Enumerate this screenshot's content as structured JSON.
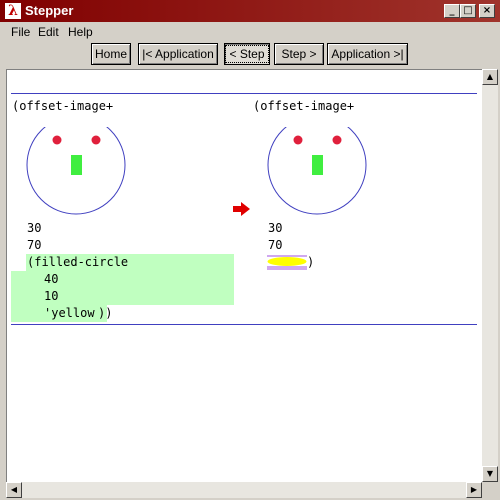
{
  "window": {
    "title": "Stepper",
    "app_icon": "λ",
    "minimize": "_",
    "maximize": "□",
    "close": "×"
  },
  "menu": {
    "items": [
      "File",
      "Edit",
      "Help"
    ]
  },
  "toolbar": {
    "home": "Home",
    "back_application": "|< Application",
    "back_step": "< Step",
    "forward_step": "Step >",
    "forward_application": "Application >|"
  },
  "left_expr": {
    "head": "(offset-image+",
    "arg1": "30",
    "arg2": "70",
    "redex_line1": "(filled-circle",
    "redex_line2": "40",
    "redex_line3": "10",
    "redex_line4": "'yellow",
    "closing": "))"
  },
  "right_expr": {
    "head": "(offset-image+",
    "arg1": "30",
    "arg2": "70",
    "closing": ")"
  },
  "colors": {
    "redex_highlight": "#c0ffc0",
    "contractum_highlight": "#d0a8f0",
    "face_outline": "#4040c0",
    "eyes": "#e0203c",
    "nose": "#40ee40",
    "result_ellipse": "#ffff00",
    "arrow": "#e00000"
  },
  "icons": {
    "arrow": "red-right-arrow",
    "scroll_up": "triangle-up",
    "scroll_down": "triangle-down",
    "scroll_left": "triangle-left",
    "scroll_right": "triangle-right"
  }
}
